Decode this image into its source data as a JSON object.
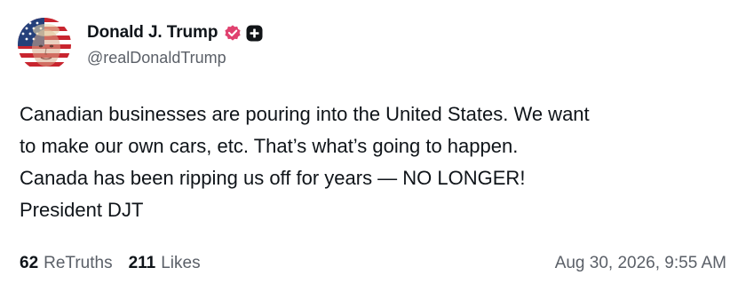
{
  "author": {
    "display_name": "Donald J. Trump",
    "handle": "@realDonaldTrump",
    "avatar_icon": "flag-face-avatar",
    "verified_icon": "verified-badge-icon",
    "verified_color": "#e0416f",
    "plus_badge_icon": "plus-badge-icon"
  },
  "post": {
    "text": "Canadian businesses are pouring into the United States. We want\nto make our own cars, etc. That’s what’s going to happen.\nCanada has been ripping us off for years — NO LONGER!\nPresident DJT"
  },
  "stats": {
    "retruths_count": "62",
    "retruths_label": "ReTruths",
    "likes_count": "211",
    "likes_label": "Likes"
  },
  "timestamp": "Aug 30, 2026, 9:55 AM",
  "colors": {
    "text_primary": "#0f1419",
    "text_secondary": "#5b6068",
    "background": "#ffffff"
  }
}
